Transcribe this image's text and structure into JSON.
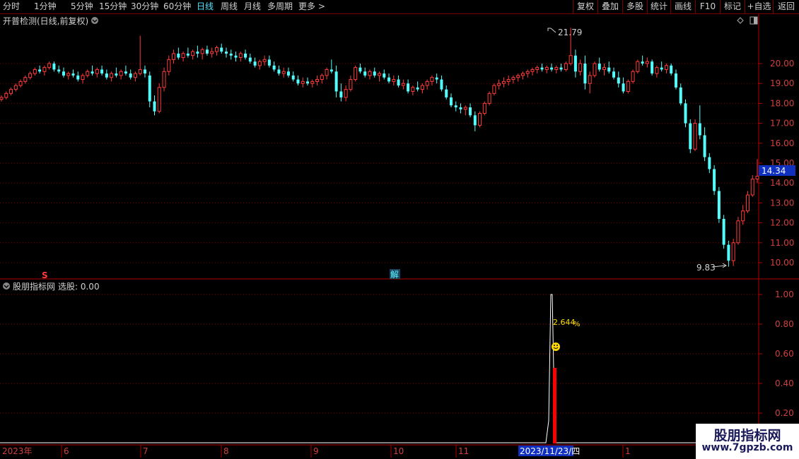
{
  "toolbar": {
    "periods": [
      "分时",
      "1分钟",
      "5分钟",
      "15分钟",
      "30分钟",
      "60分钟",
      "日线",
      "周线",
      "月线",
      "多周期",
      "更多 >"
    ],
    "active_period": "日线",
    "right_buttons": [
      "复权",
      "叠加",
      "多股",
      "统计",
      "画线",
      "F10",
      "标记",
      "+自选",
      "返回"
    ]
  },
  "main_chart": {
    "title": "开普检测(日线,前复权)",
    "price_axis": [
      "20.00",
      "19.00",
      "18.00",
      "17.00",
      "16.00",
      "15.00",
      "14.00",
      "13.00",
      "12.00",
      "11.00",
      "10.00"
    ],
    "current_price": "14.34",
    "high_marker": "21.79",
    "low_marker": "9.83",
    "marker_s": "S",
    "marker_jie": "解"
  },
  "sub_chart": {
    "title": "股朋指标网",
    "value_label": "选股: 0.00",
    "axis": [
      "1.00",
      "0.80",
      "0.60",
      "0.40",
      "0.20"
    ],
    "pct_label": "2.644",
    "pct_sign": "%"
  },
  "date_axis": {
    "year_label": "2023年",
    "months": [
      "6",
      "7",
      "8",
      "9",
      "10",
      "11",
      "1"
    ],
    "cursor_date": "2023/11/23/四"
  },
  "watermark": {
    "title": "股朋指标网",
    "url": "www.7gpzb.com"
  },
  "colors": {
    "up": "#ff3c3c",
    "down": "#54ffff",
    "grid": "#8a0000",
    "axis": "#b00000"
  },
  "chart_data": {
    "type": "candlestick",
    "y_axis_ticks": [
      10,
      11,
      12,
      13,
      14,
      15,
      16,
      17,
      18,
      19,
      20
    ],
    "candles_ohlc_approx": [
      [
        18.2,
        18.4,
        18.1,
        18.3
      ],
      [
        18.3,
        18.6,
        18.2,
        18.5
      ],
      [
        18.5,
        18.8,
        18.4,
        18.7
      ],
      [
        18.7,
        19.0,
        18.6,
        18.9
      ],
      [
        18.9,
        19.2,
        18.8,
        19.1
      ],
      [
        19.1,
        19.4,
        19.0,
        19.3
      ],
      [
        19.3,
        19.6,
        19.2,
        19.5
      ],
      [
        19.5,
        19.8,
        19.4,
        19.7
      ],
      [
        19.7,
        19.9,
        19.5,
        19.6
      ],
      [
        19.6,
        19.9,
        19.4,
        19.8
      ],
      [
        19.8,
        20.1,
        19.7,
        20.0
      ],
      [
        20.0,
        20.1,
        19.6,
        19.7
      ],
      [
        19.7,
        19.9,
        19.5,
        19.6
      ],
      [
        19.6,
        19.8,
        19.3,
        19.4
      ],
      [
        19.4,
        19.6,
        19.2,
        19.5
      ],
      [
        19.5,
        19.7,
        19.3,
        19.4
      ],
      [
        19.4,
        19.6,
        19.1,
        19.2
      ],
      [
        19.2,
        19.5,
        19.0,
        19.4
      ],
      [
        19.4,
        19.7,
        19.3,
        19.6
      ],
      [
        19.6,
        19.9,
        19.4,
        19.5
      ],
      [
        19.5,
        19.8,
        19.3,
        19.7
      ],
      [
        19.7,
        19.9,
        19.4,
        19.5
      ],
      [
        19.5,
        19.7,
        19.2,
        19.3
      ],
      [
        19.3,
        19.6,
        19.1,
        19.5
      ],
      [
        19.5,
        19.8,
        19.3,
        19.4
      ],
      [
        19.4,
        19.7,
        19.2,
        19.6
      ],
      [
        19.6,
        19.9,
        19.4,
        19.5
      ],
      [
        19.5,
        19.7,
        19.2,
        19.3
      ],
      [
        19.3,
        19.6,
        19.1,
        19.5
      ],
      [
        19.5,
        21.4,
        19.4,
        19.7
      ],
      [
        19.7,
        19.9,
        19.3,
        19.5
      ],
      [
        19.4,
        19.6,
        17.8,
        18.1
      ],
      [
        18.1,
        18.4,
        17.4,
        17.6
      ],
      [
        17.6,
        19.0,
        17.5,
        18.8
      ],
      [
        18.8,
        19.8,
        18.6,
        19.6
      ],
      [
        19.6,
        20.4,
        19.4,
        20.2
      ],
      [
        20.2,
        20.7,
        20.0,
        20.5
      ],
      [
        20.5,
        20.8,
        20.2,
        20.3
      ],
      [
        20.3,
        20.6,
        20.1,
        20.5
      ],
      [
        20.5,
        20.8,
        20.3,
        20.4
      ],
      [
        20.4,
        20.7,
        20.2,
        20.6
      ],
      [
        20.6,
        20.9,
        20.3,
        20.5
      ],
      [
        20.5,
        20.8,
        20.2,
        20.7
      ],
      [
        20.7,
        20.9,
        20.4,
        20.5
      ],
      [
        20.5,
        20.8,
        20.3,
        20.6
      ],
      [
        20.6,
        20.9,
        20.4,
        20.8
      ],
      [
        20.8,
        21.0,
        20.5,
        20.6
      ],
      [
        20.6,
        20.8,
        20.3,
        20.5
      ],
      [
        20.5,
        20.7,
        20.2,
        20.4
      ],
      [
        20.4,
        20.6,
        20.1,
        20.3
      ],
      [
        20.3,
        20.6,
        20.1,
        20.5
      ],
      [
        20.5,
        20.7,
        20.2,
        20.3
      ],
      [
        20.3,
        20.5,
        20.0,
        20.1
      ],
      [
        20.1,
        20.3,
        19.8,
        19.9
      ],
      [
        19.9,
        20.2,
        19.7,
        20.1
      ],
      [
        20.1,
        20.4,
        19.9,
        20.2
      ],
      [
        20.2,
        20.4,
        19.8,
        19.9
      ],
      [
        19.9,
        20.1,
        19.6,
        19.7
      ],
      [
        19.7,
        19.9,
        19.4,
        19.5
      ],
      [
        19.5,
        19.8,
        19.3,
        19.6
      ],
      [
        19.6,
        19.8,
        19.3,
        19.4
      ],
      [
        19.4,
        19.6,
        19.1,
        19.2
      ],
      [
        19.2,
        19.4,
        18.9,
        19.0
      ],
      [
        19.0,
        19.3,
        18.8,
        19.1
      ],
      [
        19.1,
        19.3,
        18.9,
        19.0
      ],
      [
        19.0,
        19.2,
        18.8,
        19.1
      ],
      [
        19.1,
        19.4,
        18.9,
        19.2
      ],
      [
        19.2,
        19.5,
        19.0,
        19.4
      ],
      [
        19.4,
        19.8,
        19.2,
        19.7
      ],
      [
        19.7,
        20.2,
        19.5,
        19.6
      ],
      [
        19.6,
        19.9,
        18.3,
        18.6
      ],
      [
        18.6,
        19.0,
        18.1,
        18.3
      ],
      [
        18.3,
        18.9,
        18.1,
        18.7
      ],
      [
        18.7,
        19.4,
        18.6,
        19.2
      ],
      [
        19.2,
        19.9,
        19.1,
        19.8
      ],
      [
        19.8,
        20.0,
        19.5,
        19.6
      ],
      [
        19.6,
        19.8,
        19.3,
        19.4
      ],
      [
        19.4,
        19.7,
        19.2,
        19.6
      ],
      [
        19.6,
        19.8,
        19.3,
        19.4
      ],
      [
        19.4,
        19.6,
        19.1,
        19.5
      ],
      [
        19.5,
        19.7,
        19.2,
        19.3
      ],
      [
        19.3,
        19.5,
        19.0,
        19.1
      ],
      [
        19.1,
        19.4,
        18.9,
        19.2
      ],
      [
        19.2,
        19.4,
        18.8,
        18.9
      ],
      [
        18.9,
        19.2,
        18.7,
        19.0
      ],
      [
        19.0,
        19.2,
        18.5,
        18.6
      ],
      [
        18.6,
        18.9,
        18.4,
        18.8
      ],
      [
        18.8,
        19.1,
        18.6,
        18.7
      ],
      [
        18.7,
        19.0,
        18.5,
        18.9
      ],
      [
        18.9,
        19.2,
        18.7,
        19.1
      ],
      [
        19.1,
        19.4,
        18.9,
        19.3
      ],
      [
        19.3,
        19.5,
        19.0,
        19.2
      ],
      [
        19.2,
        19.4,
        18.6,
        18.7
      ],
      [
        18.7,
        18.9,
        18.2,
        18.3
      ],
      [
        18.3,
        18.5,
        17.8,
        17.9
      ],
      [
        17.9,
        18.1,
        17.6,
        17.8
      ],
      [
        17.8,
        18.0,
        17.5,
        17.7
      ],
      [
        17.7,
        17.9,
        17.4,
        17.8
      ],
      [
        17.8,
        18.0,
        17.3,
        17.4
      ],
      [
        17.4,
        17.6,
        16.6,
        16.9
      ],
      [
        16.9,
        17.6,
        16.8,
        17.5
      ],
      [
        17.5,
        18.1,
        17.4,
        18.0
      ],
      [
        18.0,
        18.6,
        17.9,
        18.5
      ],
      [
        18.5,
        19.0,
        18.4,
        18.9
      ],
      [
        18.9,
        19.2,
        18.7,
        19.0
      ],
      [
        19.0,
        19.3,
        18.8,
        19.1
      ],
      [
        19.1,
        19.4,
        18.9,
        19.2
      ],
      [
        19.2,
        19.4,
        19.0,
        19.3
      ],
      [
        19.3,
        19.5,
        19.1,
        19.4
      ],
      [
        19.4,
        19.6,
        19.2,
        19.5
      ],
      [
        19.5,
        19.7,
        19.3,
        19.6
      ],
      [
        19.6,
        19.8,
        19.4,
        19.7
      ],
      [
        19.7,
        19.9,
        19.5,
        19.8
      ],
      [
        19.8,
        20.0,
        19.6,
        19.7
      ],
      [
        19.7,
        19.9,
        19.5,
        19.8
      ],
      [
        19.8,
        20.0,
        19.6,
        19.7
      ],
      [
        19.7,
        19.9,
        19.5,
        19.8
      ],
      [
        19.8,
        20.0,
        19.6,
        19.7
      ],
      [
        19.7,
        20.1,
        19.6,
        20.0
      ],
      [
        20.0,
        21.8,
        19.9,
        20.4
      ],
      [
        20.4,
        20.7,
        19.3,
        19.6
      ],
      [
        19.6,
        20.2,
        19.4,
        20.0
      ],
      [
        20.0,
        20.4,
        18.7,
        19.0
      ],
      [
        19.0,
        19.6,
        18.5,
        19.4
      ],
      [
        19.4,
        20.1,
        19.3,
        20.0
      ],
      [
        20.0,
        20.3,
        19.6,
        19.7
      ],
      [
        19.7,
        20.0,
        19.4,
        19.8
      ],
      [
        19.8,
        20.1,
        19.5,
        19.6
      ],
      [
        19.6,
        19.8,
        19.2,
        19.3
      ],
      [
        19.3,
        19.6,
        18.8,
        19.0
      ],
      [
        19.0,
        19.3,
        18.5,
        18.6
      ],
      [
        18.6,
        19.2,
        18.5,
        19.1
      ],
      [
        19.1,
        19.7,
        19.0,
        19.6
      ],
      [
        19.6,
        20.2,
        19.5,
        20.1
      ],
      [
        20.1,
        20.4,
        19.9,
        20.0
      ],
      [
        20.0,
        20.3,
        19.8,
        20.1
      ],
      [
        20.1,
        20.2,
        19.4,
        19.5
      ],
      [
        19.5,
        19.9,
        19.3,
        19.8
      ],
      [
        19.8,
        20.1,
        19.6,
        19.7
      ],
      [
        19.7,
        20.0,
        19.5,
        19.9
      ],
      [
        19.9,
        20.0,
        19.4,
        19.5
      ],
      [
        19.5,
        19.7,
        18.7,
        18.8
      ],
      [
        18.8,
        19.0,
        17.9,
        18.0
      ],
      [
        18.0,
        18.2,
        16.8,
        17.0
      ],
      [
        17.0,
        17.2,
        15.5,
        15.7
      ],
      [
        15.7,
        17.2,
        15.6,
        17.0
      ],
      [
        17.0,
        17.9,
        16.2,
        16.4
      ],
      [
        16.4,
        16.8,
        15.1,
        15.3
      ],
      [
        15.3,
        15.5,
        14.5,
        14.7
      ],
      [
        14.7,
        14.9,
        13.4,
        13.6
      ],
      [
        13.6,
        13.8,
        12.0,
        12.2
      ],
      [
        12.2,
        12.4,
        10.7,
        10.9
      ],
      [
        10.9,
        11.1,
        9.8,
        10.1
      ],
      [
        10.1,
        11.2,
        9.83,
        11.0
      ],
      [
        11.0,
        12.3,
        10.9,
        12.1
      ],
      [
        12.1,
        12.9,
        11.9,
        12.6
      ],
      [
        12.6,
        13.6,
        12.5,
        13.4
      ],
      [
        13.4,
        14.4,
        13.3,
        14.2
      ],
      [
        14.2,
        15.2,
        14.0,
        14.34
      ]
    ],
    "high": 21.79,
    "low": 9.83,
    "last": 14.34,
    "indicator": {
      "name": "股朋指标网",
      "y_axis_ticks": [
        0.2,
        0.4,
        0.6,
        0.8,
        1.0
      ],
      "signal_peak": 1.0,
      "signal_bar": 0.5,
      "signal_pct": 2.644
    }
  }
}
